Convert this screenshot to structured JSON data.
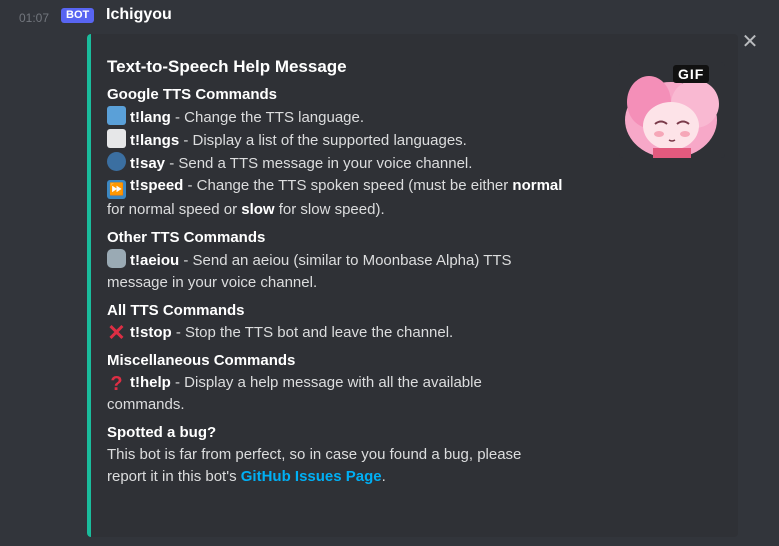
{
  "message": {
    "timestamp": "01:07",
    "bot_tag": "BOT",
    "author": "Ichigyou"
  },
  "embed": {
    "accent_color": "#1abc9c",
    "title": "Text-to-Speech Help Message",
    "thumbnail_badge": "GIF",
    "sections": {
      "google": {
        "name": "Google TTS Commands",
        "items": [
          {
            "icon": "world-map-icon",
            "cmd": "t!lang",
            "desc": " - Change the TTS language."
          },
          {
            "icon": "page-icon",
            "cmd": "t!langs",
            "desc": " - Display a list of the supported languages."
          },
          {
            "icon": "speaking-head-icon",
            "cmd": "t!say",
            "desc": " - Send a TTS message in your voice channel."
          }
        ],
        "speed": {
          "icon": "fast-forward-icon",
          "cmd": "t!speed",
          "desc1": " - Change the TTS spoken speed (must be either ",
          "bold1": "normal",
          "desc2": "for normal speed or ",
          "bold2": "slow",
          "desc3": " for slow speed)."
        }
      },
      "other": {
        "name": "Other TTS Commands",
        "icon": "robot-icon",
        "cmd": "t!aeiou",
        "desc1": " - Send an aeiou (similar to Moonbase Alpha) TTS",
        "desc2": "message in your voice channel."
      },
      "all": {
        "name": "All TTS Commands",
        "icon": "cross-mark-icon",
        "cmd": "t!stop",
        "desc": " - Stop the TTS bot and leave the channel."
      },
      "misc": {
        "name": "Miscellaneous Commands",
        "icon": "question-mark-icon",
        "cmd": "t!help",
        "desc1": " - Display a help message with all the available",
        "desc2": "commands."
      },
      "bug": {
        "name": "Spotted a bug?",
        "line1": "This bot is far from perfect, so in case you found a bug, please",
        "line2a": "report it in this bot's ",
        "link": "GitHub Issues Page",
        "line2b": "."
      }
    }
  }
}
